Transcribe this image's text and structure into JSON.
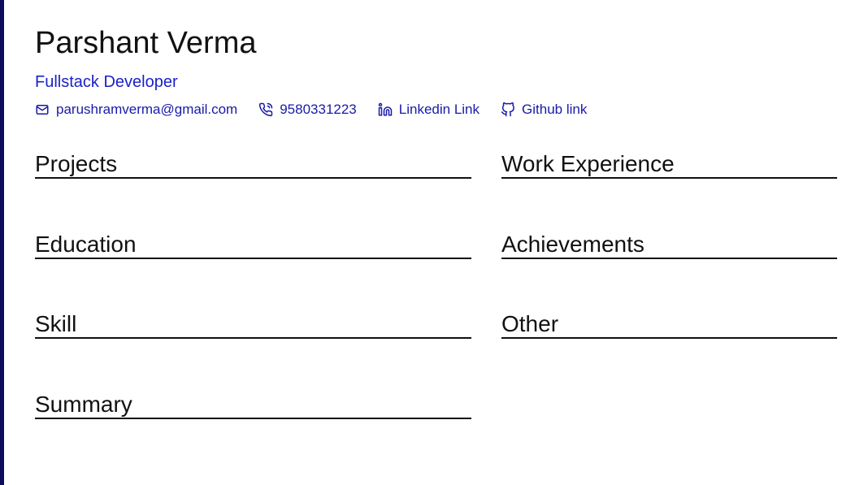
{
  "profile": {
    "name": "Parshant Verma",
    "role": "Fullstack Developer"
  },
  "contacts": {
    "email": "parushramverma@gmail.com",
    "phone": "9580331223",
    "linkedin": "Linkedin Link",
    "github": "Github link"
  },
  "sections": {
    "projects": "Projects",
    "work_experience": "Work Experience",
    "education": "Education",
    "achievements": "Achievements",
    "skill": "Skill",
    "other": "Other",
    "summary": "Summary"
  },
  "colors": {
    "accent": "#1a22c8",
    "link": "#1a1aa8",
    "side_bar": "#0b0b5e",
    "text": "#111111"
  },
  "icons": [
    "mail-icon",
    "phone-icon",
    "linkedin-icon",
    "github-icon"
  ]
}
